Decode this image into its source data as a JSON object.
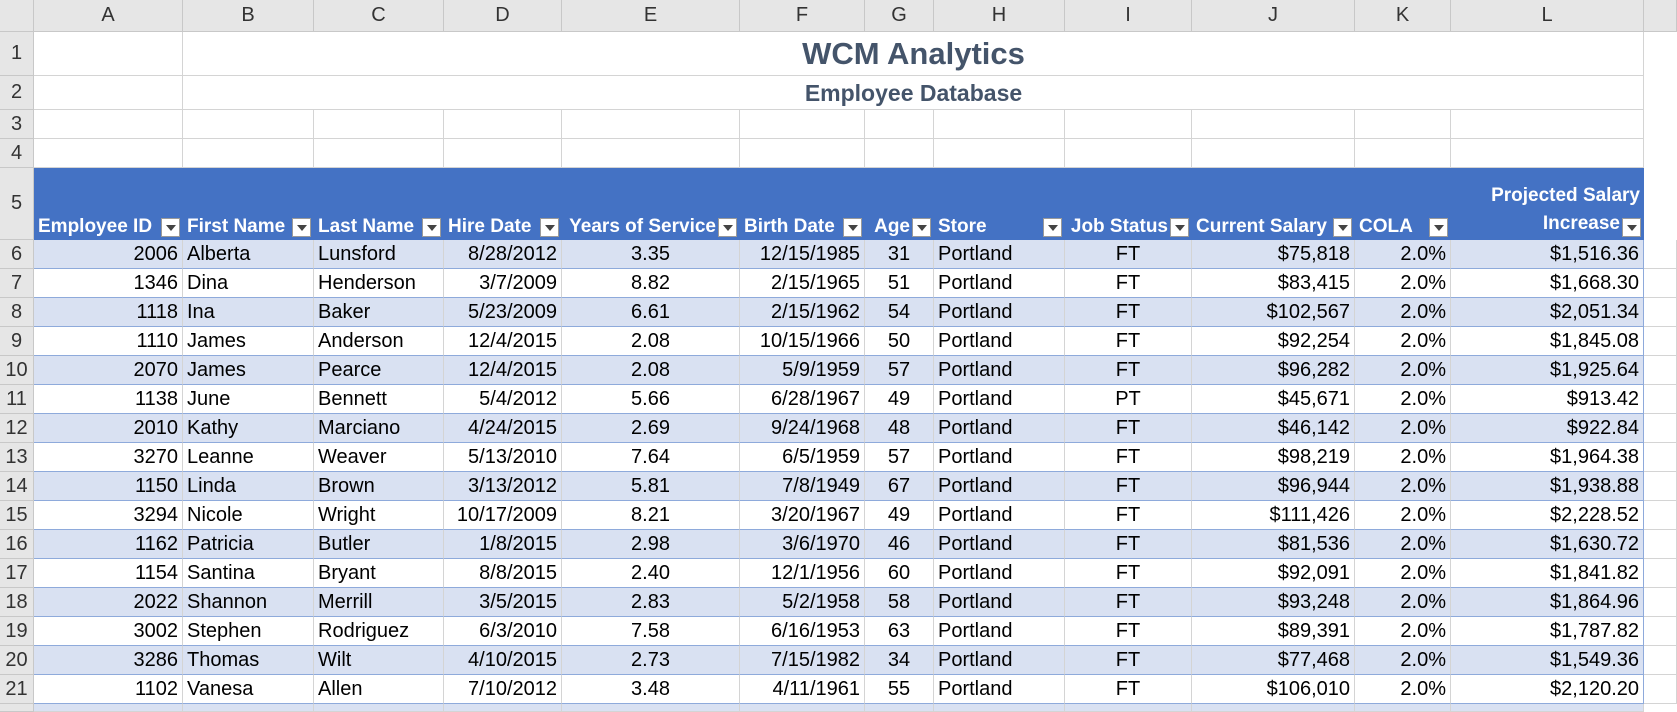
{
  "columns": [
    "A",
    "B",
    "C",
    "D",
    "E",
    "F",
    "G",
    "H",
    "I",
    "J",
    "K",
    "L"
  ],
  "rows": [
    "1",
    "2",
    "3",
    "4",
    "5",
    "6",
    "7",
    "8",
    "9",
    "10",
    "11",
    "12",
    "13",
    "14",
    "15",
    "16",
    "17",
    "18",
    "19",
    "20",
    "21"
  ],
  "title": "WCM Analytics",
  "subtitle": "Employee Database",
  "headers": [
    "Employee ID",
    "First Name",
    "Last Name",
    "Hire Date",
    "Years of Service",
    "Birth Date",
    "Age",
    "Store",
    "Job Status",
    "Current Salary",
    "COLA",
    "Projected Salary",
    "Increase"
  ],
  "data": [
    [
      "2006",
      "Alberta",
      "Lunsford",
      "8/28/2012",
      "3.35",
      "12/15/1985",
      "31",
      "Portland",
      "FT",
      "$75,818",
      "2.0%",
      "$1,516.36"
    ],
    [
      "1346",
      "Dina",
      "Henderson",
      "3/7/2009",
      "8.82",
      "2/15/1965",
      "51",
      "Portland",
      "FT",
      "$83,415",
      "2.0%",
      "$1,668.30"
    ],
    [
      "1118",
      "Ina",
      "Baker",
      "5/23/2009",
      "6.61",
      "2/15/1962",
      "54",
      "Portland",
      "FT",
      "$102,567",
      "2.0%",
      "$2,051.34"
    ],
    [
      "1110",
      "James",
      "Anderson",
      "12/4/2015",
      "2.08",
      "10/15/1966",
      "50",
      "Portland",
      "FT",
      "$92,254",
      "2.0%",
      "$1,845.08"
    ],
    [
      "2070",
      "James",
      "Pearce",
      "12/4/2015",
      "2.08",
      "5/9/1959",
      "57",
      "Portland",
      "FT",
      "$96,282",
      "2.0%",
      "$1,925.64"
    ],
    [
      "1138",
      "June",
      "Bennett",
      "5/4/2012",
      "5.66",
      "6/28/1967",
      "49",
      "Portland",
      "PT",
      "$45,671",
      "2.0%",
      "$913.42"
    ],
    [
      "2010",
      "Kathy",
      "Marciano",
      "4/24/2015",
      "2.69",
      "9/24/1968",
      "48",
      "Portland",
      "FT",
      "$46,142",
      "2.0%",
      "$922.84"
    ],
    [
      "3270",
      "Leanne",
      "Weaver",
      "5/13/2010",
      "7.64",
      "6/5/1959",
      "57",
      "Portland",
      "FT",
      "$98,219",
      "2.0%",
      "$1,964.38"
    ],
    [
      "1150",
      "Linda",
      "Brown",
      "3/13/2012",
      "5.81",
      "7/8/1949",
      "67",
      "Portland",
      "FT",
      "$96,944",
      "2.0%",
      "$1,938.88"
    ],
    [
      "3294",
      "Nicole",
      "Wright",
      "10/17/2009",
      "8.21",
      "3/20/1967",
      "49",
      "Portland",
      "FT",
      "$111,426",
      "2.0%",
      "$2,228.52"
    ],
    [
      "1162",
      "Patricia",
      "Butler",
      "1/8/2015",
      "2.98",
      "3/6/1970",
      "46",
      "Portland",
      "FT",
      "$81,536",
      "2.0%",
      "$1,630.72"
    ],
    [
      "1154",
      "Santina",
      "Bryant",
      "8/8/2015",
      "2.40",
      "12/1/1956",
      "60",
      "Portland",
      "FT",
      "$92,091",
      "2.0%",
      "$1,841.82"
    ],
    [
      "2022",
      "Shannon",
      "Merrill",
      "3/5/2015",
      "2.83",
      "5/2/1958",
      "58",
      "Portland",
      "FT",
      "$93,248",
      "2.0%",
      "$1,864.96"
    ],
    [
      "3002",
      "Stephen",
      "Rodriguez",
      "6/3/2010",
      "7.58",
      "6/16/1953",
      "63",
      "Portland",
      "FT",
      "$89,391",
      "2.0%",
      "$1,787.82"
    ],
    [
      "3286",
      "Thomas",
      "Wilt",
      "4/10/2015",
      "2.73",
      "7/15/1982",
      "34",
      "Portland",
      "FT",
      "$77,468",
      "2.0%",
      "$1,549.36"
    ],
    [
      "1102",
      "Vanesa",
      "Allen",
      "7/10/2012",
      "3.48",
      "4/11/1961",
      "55",
      "Portland",
      "FT",
      "$106,010",
      "2.0%",
      "$2,120.20"
    ]
  ]
}
